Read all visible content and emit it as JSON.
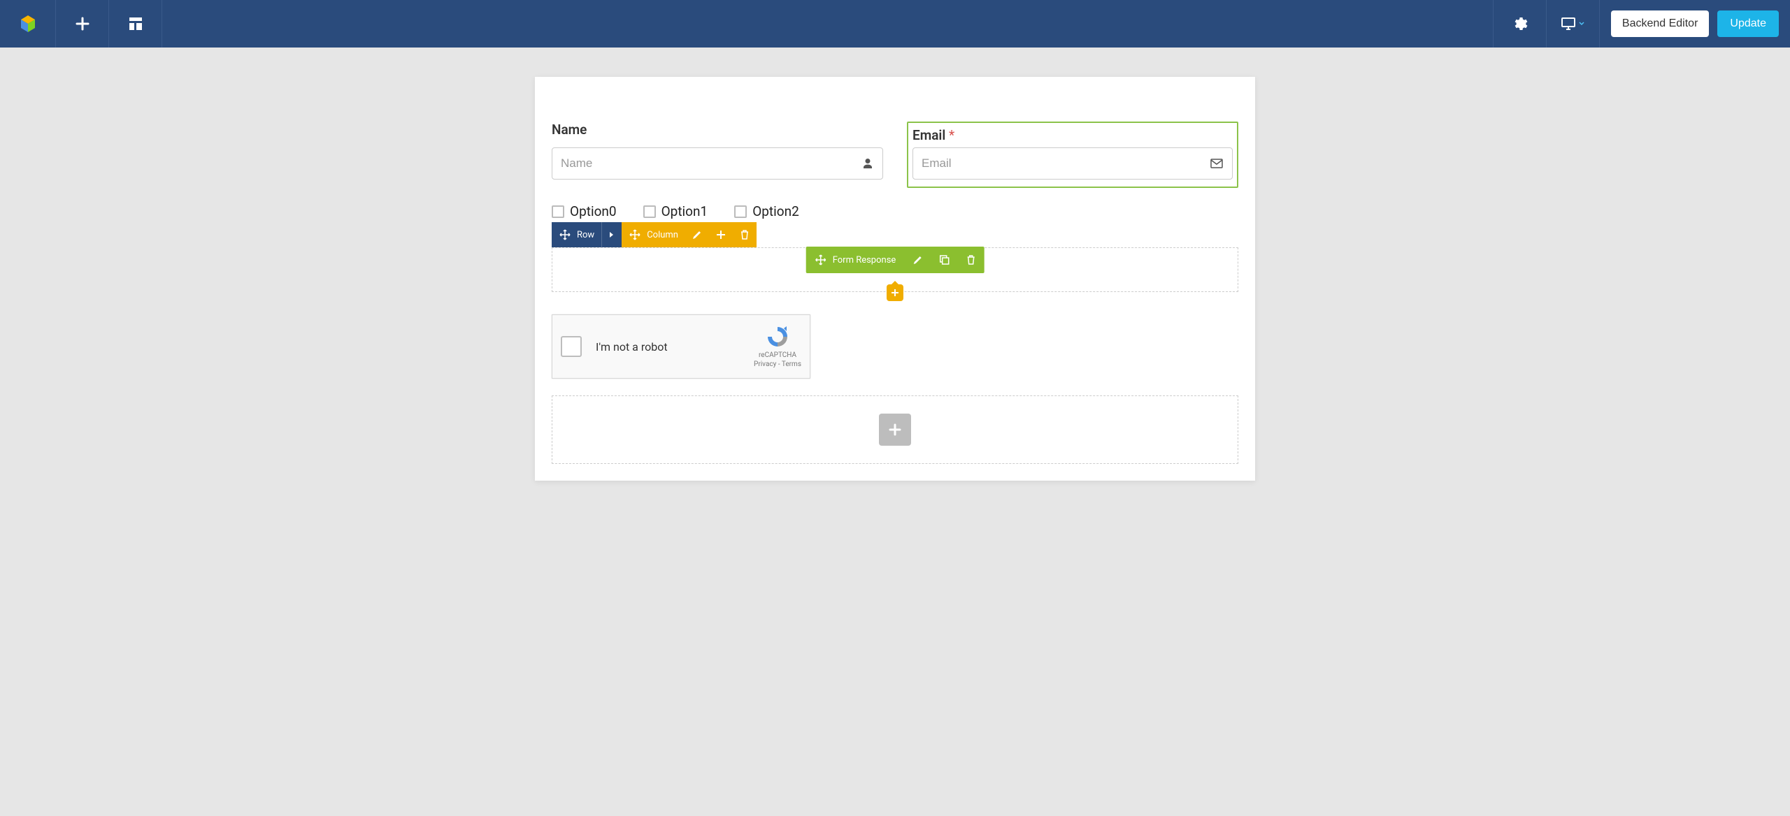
{
  "topbar": {
    "backend_editor_label": "Backend Editor",
    "update_label": "Update"
  },
  "form": {
    "name": {
      "label": "Name",
      "placeholder": "Name"
    },
    "email": {
      "label": "Email",
      "required_marker": "*",
      "placeholder": "Email"
    },
    "options": [
      "Option0",
      "Option1",
      "Option2"
    ]
  },
  "controls": {
    "row_label": "Row",
    "column_label": "Column",
    "form_response_label": "Form Response"
  },
  "recaptcha": {
    "text": "I'm not a robot",
    "brand": "reCAPTCHA",
    "links": "Privacy - Terms"
  }
}
